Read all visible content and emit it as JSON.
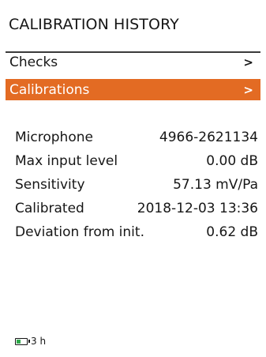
{
  "screen": {
    "title": "CALIBRATION HISTORY"
  },
  "menu": [
    {
      "label": "Checks",
      "arrow": ">",
      "selected": false
    },
    {
      "label": "Calibrations",
      "arrow": ">",
      "selected": true
    }
  ],
  "info": {
    "microphone": {
      "label": "Microphone",
      "value": "4966-2621134"
    },
    "max_input": {
      "label": "Max input level",
      "value": "0.00 dB"
    },
    "sensitivity": {
      "label": "Sensitivity",
      "value": "57.13 mV/Pa"
    },
    "calibrated": {
      "label": "Calibrated",
      "value": "2018-12-03 13:36"
    },
    "deviation": {
      "label": "Deviation from init.",
      "value": "0.62 dB"
    }
  },
  "status": {
    "battery_icon": "battery-icon",
    "battery_level": 0.35,
    "battery_time": "3 h"
  },
  "colors": {
    "accent": "#e36b23",
    "battery_fill": "#2fa84a",
    "text": "#161616"
  }
}
